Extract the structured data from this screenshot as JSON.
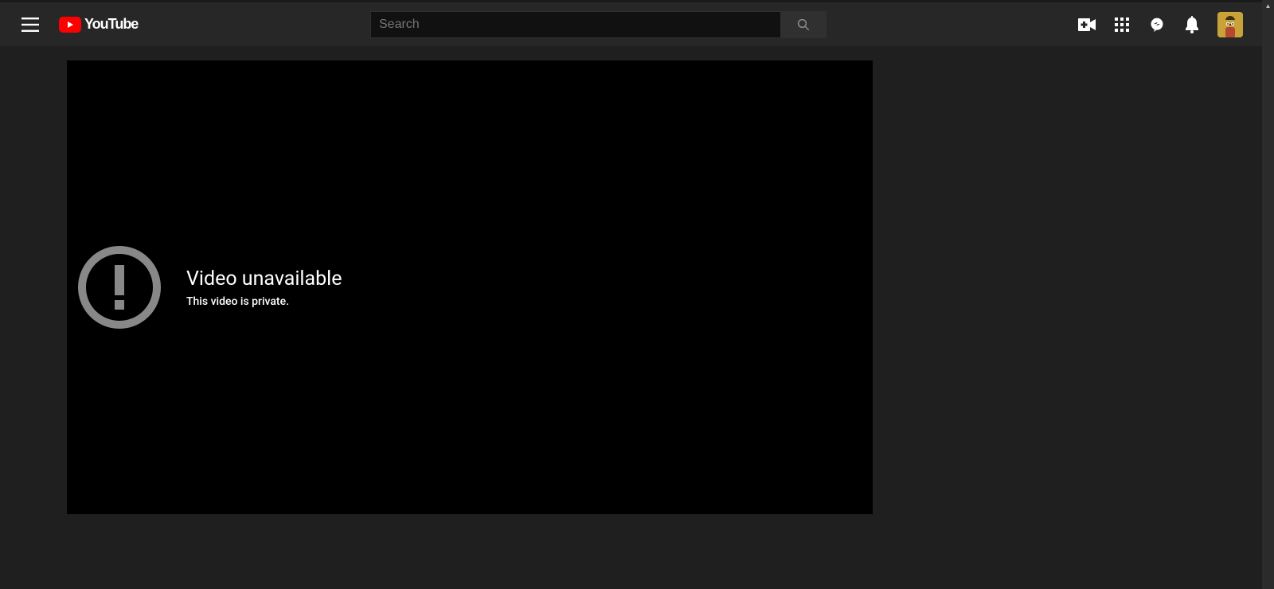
{
  "header": {
    "logo_text": "YouTube",
    "search_placeholder": "Search",
    "search_value": ""
  },
  "player_error": {
    "title": "Video unavailable",
    "subtitle": "This video is private."
  }
}
